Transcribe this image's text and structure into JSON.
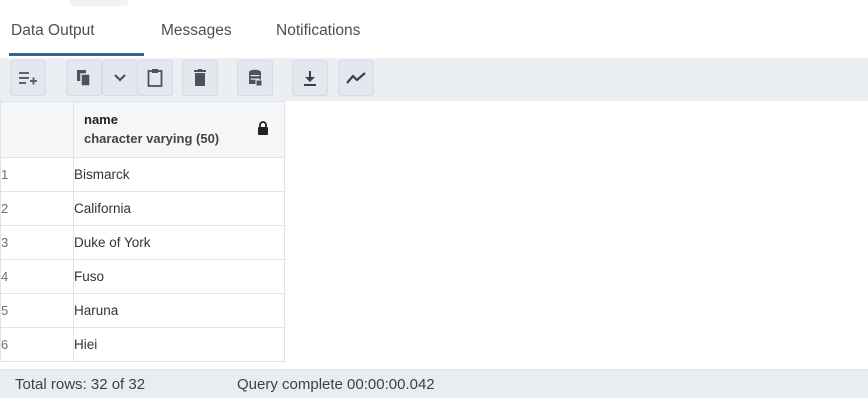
{
  "tabs": [
    {
      "label": "Data Output",
      "active": true
    },
    {
      "label": "Messages",
      "active": false
    },
    {
      "label": "Notifications",
      "active": false
    }
  ],
  "toolbar": {
    "buttons": [
      {
        "icon": "add-row-icon"
      },
      {
        "icon": "copy-icon"
      },
      {
        "icon": "chevron-down-icon"
      },
      {
        "icon": "paste-icon"
      },
      {
        "icon": "delete-icon"
      },
      {
        "icon": "save-data-icon"
      },
      {
        "icon": "download-icon"
      },
      {
        "icon": "graph-visualiser-icon"
      }
    ]
  },
  "grid": {
    "column": {
      "name": "name",
      "type": "character varying (50)",
      "locked_icon": "lock-icon"
    },
    "rows": [
      {
        "num": "1",
        "value": "Bismarck"
      },
      {
        "num": "2",
        "value": "California"
      },
      {
        "num": "3",
        "value": "Duke of York"
      },
      {
        "num": "4",
        "value": "Fuso"
      },
      {
        "num": "5",
        "value": "Haruna"
      },
      {
        "num": "6",
        "value": "Hiei"
      }
    ]
  },
  "status": {
    "total_rows": "Total rows: 32 of 32",
    "query": "Query complete 00:00:00.042"
  },
  "colors": {
    "accent": "#326690",
    "toolbar_bg": "#ebeef3",
    "status_bg": "#e9ecf1"
  }
}
